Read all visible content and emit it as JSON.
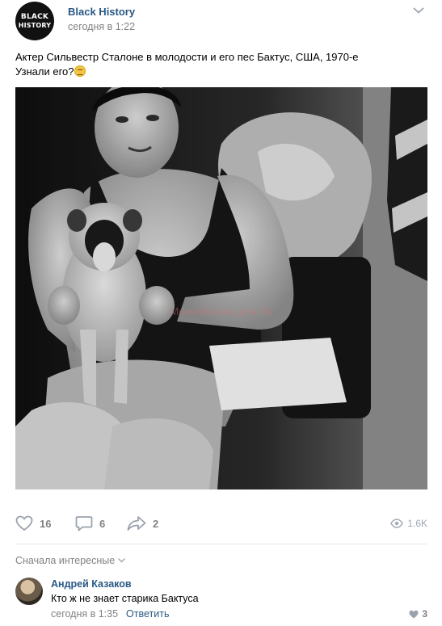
{
  "post": {
    "group_avatar_line1": "BLACK",
    "group_avatar_line2": "HISTORY",
    "group_name": "Black History",
    "time": "сегодня в 1:22",
    "text_line1": "Актер Сильвестр Сталоне в молодости и его пес Бактус, США, 1970-е",
    "text_line2": "Узнали его?",
    "emoji_icon": "relieved-face-icon",
    "photo_watermark": "Монифбунаш для ХК"
  },
  "actions": {
    "likes": "16",
    "comments": "6",
    "shares": "2",
    "views": "1.6K"
  },
  "comments_section": {
    "sort_label": "Сначала интересные",
    "items": [
      {
        "author": "Андрей Казаков",
        "text": "Кто ж не знает старика Бактуса",
        "time": "сегодня в 1:35",
        "reply_label": "Ответить",
        "likes": "3"
      }
    ]
  },
  "colors": {
    "link": "#2a5885",
    "muted": "#828282",
    "icon": "#99a2ad",
    "divider": "#e7e8ec"
  }
}
